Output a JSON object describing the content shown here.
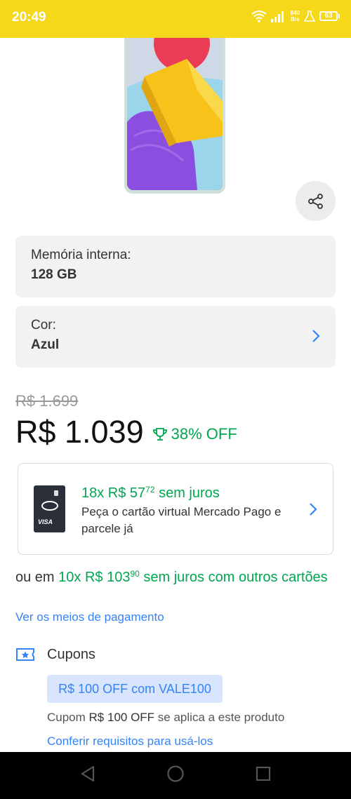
{
  "status_bar": {
    "time": "20:49",
    "net_speed_value": "840",
    "net_speed_unit": "B/s",
    "battery": "63",
    "icons": [
      "wifi-icon",
      "signal-icon",
      "flask-icon",
      "battery-icon"
    ]
  },
  "product": {
    "image": "phone-image",
    "share_icon": "share-icon"
  },
  "variations": [
    {
      "label": "Memória interna:",
      "value": "128 GB"
    },
    {
      "label": "Cor:",
      "value": "Azul"
    }
  ],
  "price": {
    "original": "R$ 1.699",
    "current": "R$ 1.039",
    "discount": "38% OFF"
  },
  "installments": {
    "main": "18x R$ 57",
    "cents": "72",
    "interest": " sem juros",
    "description": "Peça o cartão virtual Mercado Pago e parcele já",
    "card_brand": "VISA"
  },
  "other_cards": {
    "prefix": "ou em ",
    "main": "10x R$ 103",
    "cents": "90",
    "suffix": " sem juros com outros cartões"
  },
  "payment_link": "Ver os meios de pagamento",
  "coupons": {
    "title": "Cupons",
    "tag": "R$ 100 OFF com VALE100",
    "desc_prefix": "Cupom ",
    "desc_amount": "R$ 100 OFF",
    "desc_suffix": " se aplica a este produto",
    "link": "Conferir requisitos para usá-los"
  },
  "colors": {
    "brand_yellow": "#f5d81a",
    "accent_green": "#00a650",
    "link_blue": "#3483fa"
  }
}
